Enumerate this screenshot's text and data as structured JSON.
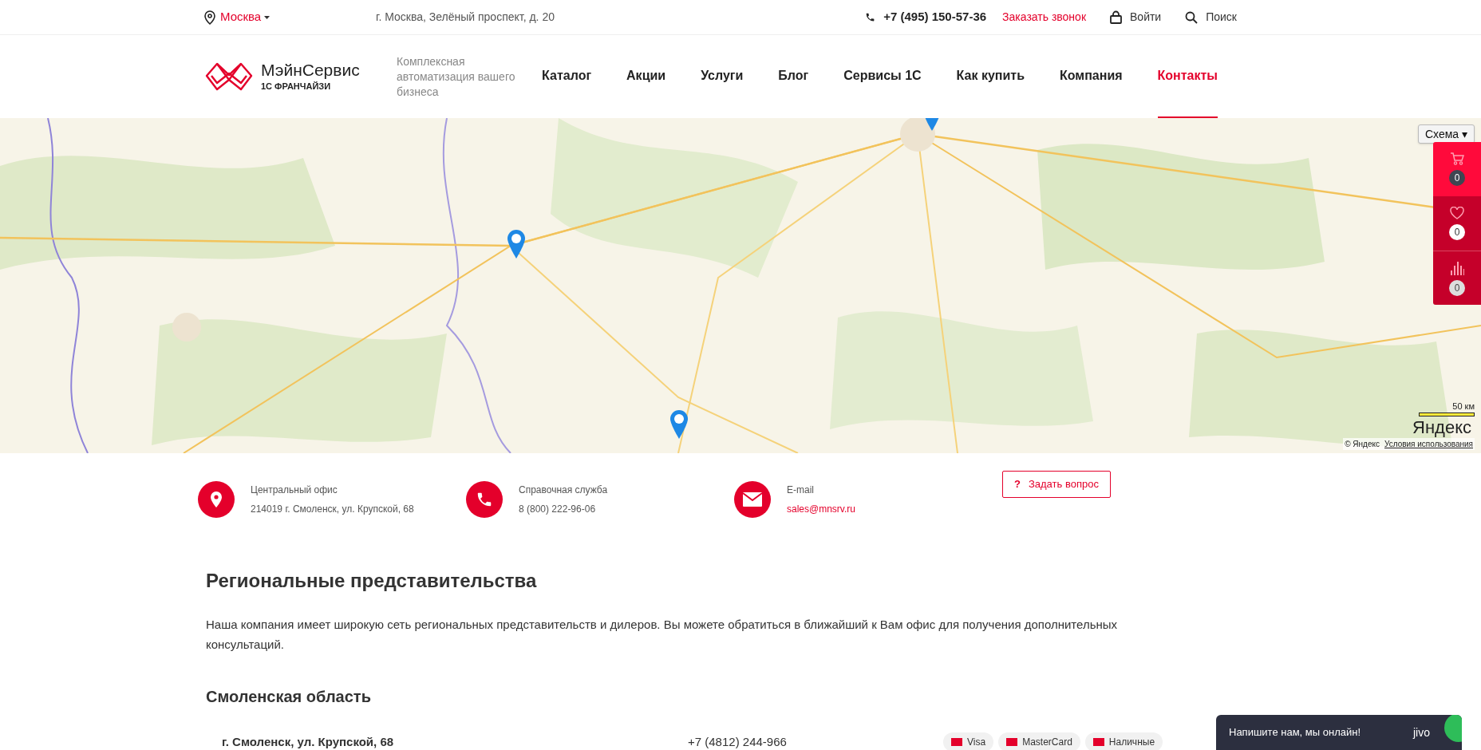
{
  "topbar": {
    "city": "Москва",
    "address": "г. Москва, Зелёный проспект, д. 20",
    "phone": "+7 (495) 150-57-36",
    "callback": "Заказать звонок",
    "login": "Войти",
    "search": "Поиск"
  },
  "logo": {
    "name": "МэйнСервис",
    "subtitle": "1С ФРАНЧАЙЗИ",
    "tagline": "Комплексная автоматизация вашего бизнеса"
  },
  "nav": [
    {
      "label": "Каталог",
      "selected": false
    },
    {
      "label": "Акции",
      "selected": false
    },
    {
      "label": "Услуги",
      "selected": false
    },
    {
      "label": "Блог",
      "selected": false
    },
    {
      "label": "Сервисы 1С",
      "selected": false
    },
    {
      "label": "Как купить",
      "selected": false
    },
    {
      "label": "Компания",
      "selected": false
    },
    {
      "label": "Контакты",
      "selected": true
    }
  ],
  "map": {
    "layer_button": "Схема ▾",
    "scale": "50 км",
    "brand": "Яндекс",
    "copyright": "© Яндекс",
    "terms": "Условия использования"
  },
  "side_panel": [
    {
      "kind": "cart",
      "count": "0"
    },
    {
      "kind": "favorites",
      "count": "0"
    },
    {
      "kind": "compare",
      "count": "0"
    }
  ],
  "contacts": [
    {
      "kind": "office",
      "label": "Центральный офис",
      "value": "214019 г. Смоленск, ул. Крупской, 68"
    },
    {
      "kind": "phone",
      "label": "Справочная служба",
      "value": "8 (800) 222-96-06"
    },
    {
      "kind": "email",
      "label": "E-mail",
      "value": "sales@mnsrv.ru"
    }
  ],
  "ask_button": {
    "icon": "?",
    "label": "Задать вопрос"
  },
  "section_title": "Региональные представительства",
  "section_text": "Наша компания имеет широкую сеть региональных представительств и дилеров. Вы можете обратиться в ближайший к Вам офис для получения дополнительных консультаций.",
  "region_title": "Смоленская область",
  "office_row": {
    "address": "г. Смоленск, ул. Крупской, 68",
    "phone": "+7 (4812) 244-966",
    "payments": [
      "Visa",
      "MasterCard",
      "Наличные"
    ]
  },
  "chat": {
    "text": "Напишите нам, мы онлайн!",
    "brand": "jivo"
  }
}
